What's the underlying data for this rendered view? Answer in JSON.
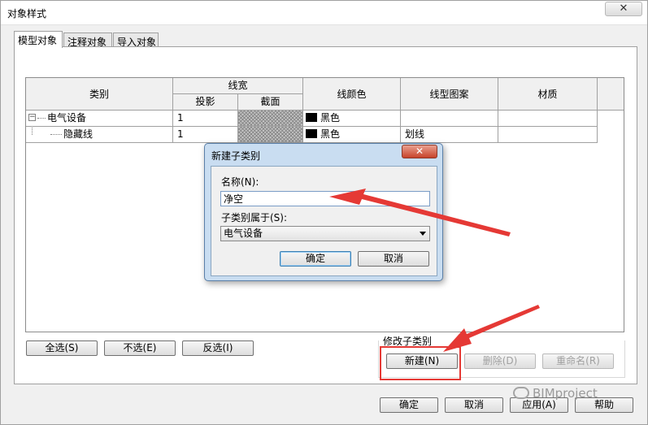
{
  "window": {
    "title": "对象样式",
    "close_label": "✕"
  },
  "tabs": [
    {
      "label": "模型对象"
    },
    {
      "label": "注释对象"
    },
    {
      "label": "导入对象"
    }
  ],
  "table": {
    "headers": {
      "category": "类别",
      "line_width": "线宽",
      "projection": "投影",
      "cut": "截面",
      "line_color": "线颜色",
      "line_pattern": "线型图案",
      "material": "材质"
    },
    "rows": [
      {
        "expander": "−",
        "category": "电气设备",
        "projection": "1",
        "color_name": "黑色",
        "pattern": "",
        "material": ""
      },
      {
        "expander": "",
        "category": "隐藏线",
        "projection": "1",
        "color_name": "黑色",
        "pattern": "划线",
        "material": ""
      }
    ]
  },
  "selection_buttons": {
    "select_all": "全选(S)",
    "select_none": "不选(E)",
    "invert": "反选(I)"
  },
  "modify_subcategories": {
    "label": "修改子类别",
    "new": "新建(N)",
    "delete": "删除(D)",
    "rename": "重命名(R)"
  },
  "footer": {
    "ok": "确定",
    "cancel": "取消",
    "apply": "应用(A)",
    "help": "帮助"
  },
  "dialog": {
    "title": "新建子类别",
    "close_label": "✕",
    "name_label": "名称(N):",
    "name_value": "净空",
    "parent_label": "子类别属于(S):",
    "parent_value": "电气设备",
    "ok": "确定",
    "cancel": "取消"
  },
  "watermark": "BIMproject",
  "colors": {
    "annotation_red": "#e53935"
  }
}
